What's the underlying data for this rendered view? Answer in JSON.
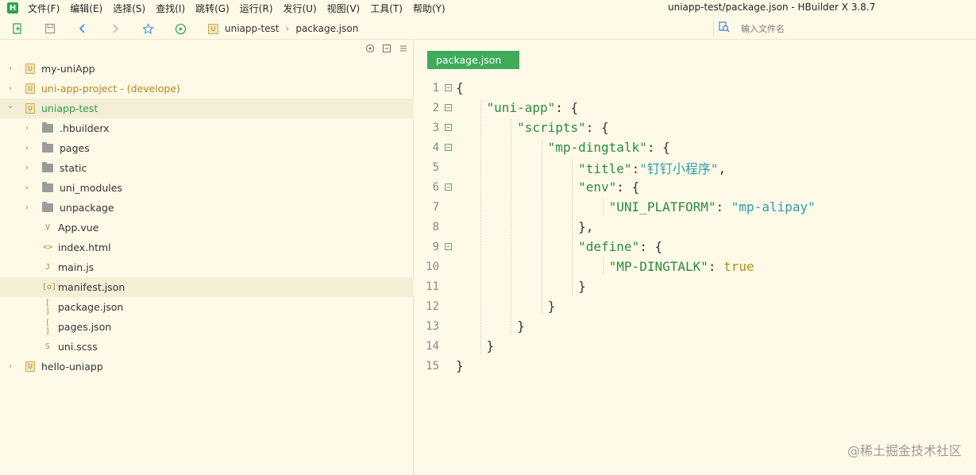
{
  "app": {
    "logo_letter": "H",
    "window_title": "uniapp-test/package.json - HBuilder X 3.8.7"
  },
  "menu": [
    "文件(F)",
    "编辑(E)",
    "选择(S)",
    "查找(I)",
    "跳转(G)",
    "运行(R)",
    "发行(U)",
    "视图(V)",
    "工具(T)",
    "帮助(Y)"
  ],
  "toolbar": {
    "breadcrumb": [
      "uniapp-test",
      "package.json"
    ],
    "search_placeholder": "输入文件名"
  },
  "sidebar": {
    "items": [
      {
        "label": "my-uniApp",
        "type": "project",
        "expanded": false,
        "depth": 0
      },
      {
        "label": "uni-app-project - (develope)",
        "type": "project",
        "expanded": false,
        "depth": 0,
        "color": "#b7861e"
      },
      {
        "label": "uniapp-test",
        "type": "project",
        "expanded": true,
        "depth": 0,
        "color": "#2ca04a",
        "selected": true
      },
      {
        "label": ".hbuilderx",
        "type": "folder",
        "depth": 1
      },
      {
        "label": "pages",
        "type": "folder",
        "depth": 1
      },
      {
        "label": "static",
        "type": "folder",
        "depth": 1
      },
      {
        "label": "uni_modules",
        "type": "folder",
        "depth": 1
      },
      {
        "label": "unpackage",
        "type": "folder",
        "depth": 1
      },
      {
        "label": "App.vue",
        "type": "file",
        "icon": "V",
        "depth": 1
      },
      {
        "label": "index.html",
        "type": "file",
        "icon": "<>",
        "depth": 1
      },
      {
        "label": "main.js",
        "type": "file",
        "icon": "J",
        "depth": 1
      },
      {
        "label": "manifest.json",
        "type": "file",
        "icon": "[o]",
        "depth": 1,
        "selected": true
      },
      {
        "label": "package.json",
        "type": "file",
        "icon": "[ ]",
        "depth": 1
      },
      {
        "label": "pages.json",
        "type": "file",
        "icon": "[ ]",
        "depth": 1
      },
      {
        "label": "uni.scss",
        "type": "file",
        "icon": "S",
        "depth": 1
      },
      {
        "label": "hello-uniapp",
        "type": "project",
        "expanded": false,
        "depth": 0
      }
    ]
  },
  "editor": {
    "tab_label": "package.json",
    "lines": [
      {
        "n": "1",
        "fold": true,
        "tokens": [
          [
            "p",
            "{"
          ]
        ]
      },
      {
        "n": "2",
        "fold": true,
        "tokens": [
          [
            "p",
            "    "
          ],
          [
            "k",
            "\"uni-app\""
          ],
          [
            "p",
            ": {"
          ]
        ]
      },
      {
        "n": "3",
        "fold": true,
        "tokens": [
          [
            "p",
            "        "
          ],
          [
            "k",
            "\"scripts\""
          ],
          [
            "p",
            ": {"
          ]
        ]
      },
      {
        "n": "4",
        "fold": true,
        "tokens": [
          [
            "p",
            "            "
          ],
          [
            "k",
            "\"mp-dingtalk\""
          ],
          [
            "p",
            ": {"
          ]
        ]
      },
      {
        "n": "5",
        "fold": false,
        "tokens": [
          [
            "p",
            "                "
          ],
          [
            "k",
            "\"title\""
          ],
          [
            "p",
            ":"
          ],
          [
            "s",
            "\"钉钉小程序\""
          ],
          [
            "p",
            ","
          ]
        ]
      },
      {
        "n": "6",
        "fold": true,
        "tokens": [
          [
            "p",
            "                "
          ],
          [
            "k",
            "\"env\""
          ],
          [
            "p",
            ": {"
          ]
        ]
      },
      {
        "n": "7",
        "fold": false,
        "tokens": [
          [
            "p",
            "                    "
          ],
          [
            "k",
            "\"UNI_PLATFORM\""
          ],
          [
            "p",
            ": "
          ],
          [
            "s",
            "\"mp-alipay\""
          ]
        ]
      },
      {
        "n": "8",
        "fold": false,
        "tokens": [
          [
            "p",
            "                },"
          ]
        ]
      },
      {
        "n": "9",
        "fold": true,
        "tokens": [
          [
            "p",
            "                "
          ],
          [
            "k",
            "\"define\""
          ],
          [
            "p",
            ": {"
          ]
        ]
      },
      {
        "n": "10",
        "fold": false,
        "tokens": [
          [
            "p",
            "                    "
          ],
          [
            "k",
            "\"MP-DINGTALK\""
          ],
          [
            "p",
            ": "
          ],
          [
            "b",
            "true"
          ]
        ]
      },
      {
        "n": "11",
        "fold": false,
        "tokens": [
          [
            "p",
            "                }"
          ]
        ]
      },
      {
        "n": "12",
        "fold": false,
        "tokens": [
          [
            "p",
            "            }"
          ]
        ]
      },
      {
        "n": "13",
        "fold": false,
        "tokens": [
          [
            "p",
            "        }"
          ]
        ]
      },
      {
        "n": "14",
        "fold": false,
        "tokens": [
          [
            "p",
            "    }"
          ]
        ]
      },
      {
        "n": "15",
        "fold": false,
        "tokens": [
          [
            "p",
            "}"
          ]
        ]
      }
    ]
  },
  "watermark": "@稀土掘金技术社区"
}
